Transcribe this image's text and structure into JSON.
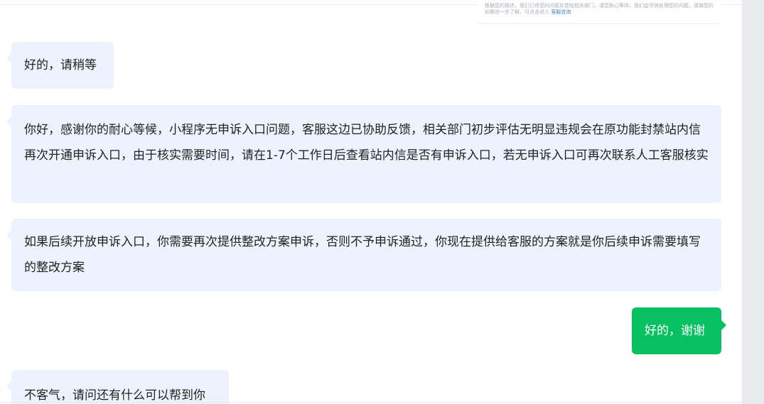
{
  "prev_card": {
    "line1": "根据您的描述，我们已将您的问题反馈给相关部门，请您耐心等待，我们会尽快处理您的问题，感谢您的理解与支持。",
    "line2_text": "如需进一步了解，可点击进入",
    "line2_link": "客服咨询"
  },
  "messages": [
    {
      "side": "left",
      "text": "好的，请稍等"
    },
    {
      "side": "left",
      "text": "你好，感谢你的耐心等候，小程序无申诉入口问题，客服这边已协助反馈，相关部门初步评估无明显违规会在原功能封禁站内信再次开通申诉入口，由于核实需要时间，请在1-7个工作日后查看站内信是否有申诉入口，若无申诉入口可再次联系人工客服核实"
    },
    {
      "side": "left",
      "text": "如果后续开放申诉入口，你需要再次提供整改方案申诉，否则不予申诉通过，你现在提供给客服的方案就是你后续申诉需要填写的整改方案"
    },
    {
      "side": "right",
      "text": "好的，谢谢"
    },
    {
      "side": "left",
      "text": "不客气，请问还有什么可以帮到你"
    }
  ],
  "colors": {
    "agent_bubble": "#edf3fd",
    "user_bubble": "#07c160",
    "text": "#222222"
  }
}
